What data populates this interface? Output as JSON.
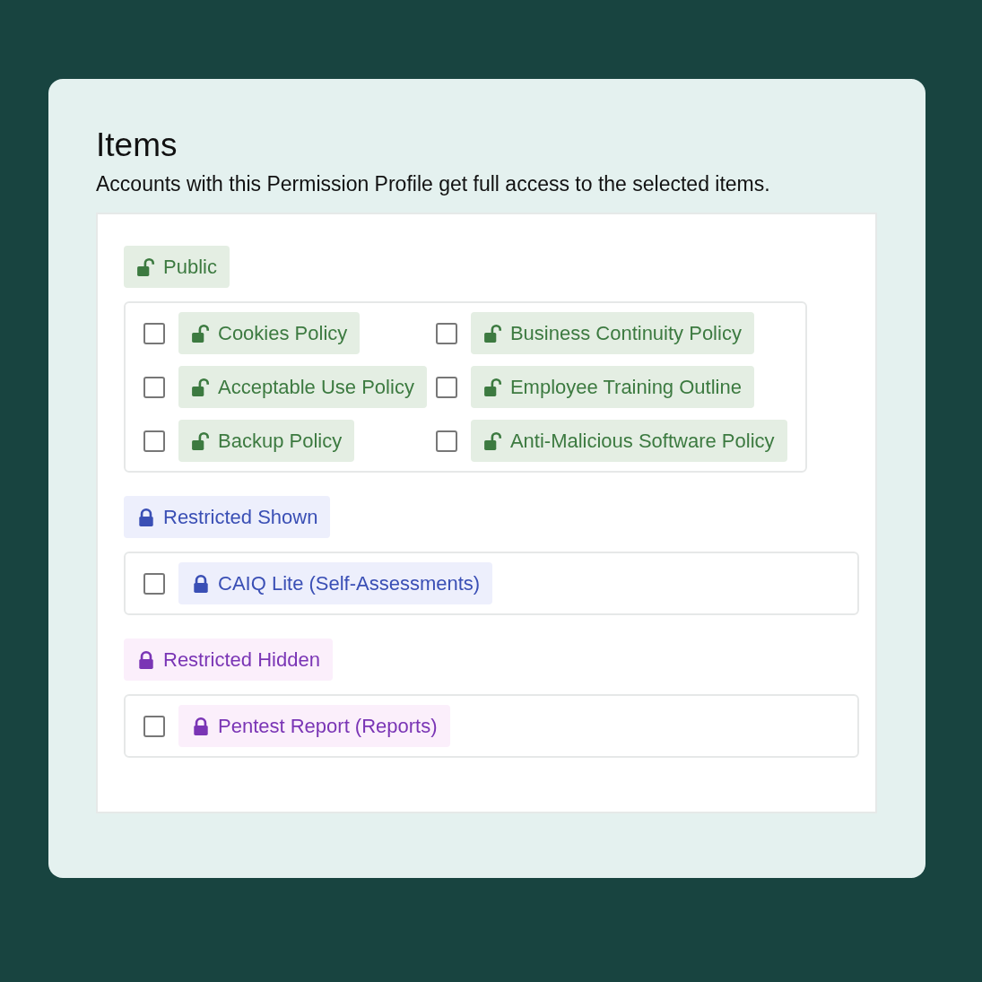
{
  "title": "Items",
  "description": "Accounts with this Permission Profile get full access to the selected items.",
  "groups": [
    {
      "kind": "public",
      "label": "Public",
      "items": [
        {
          "label": "Cookies Policy",
          "checked": false
        },
        {
          "label": "Business Continuity Policy",
          "checked": false
        },
        {
          "label": "Acceptable Use Policy",
          "checked": false
        },
        {
          "label": "Employee Training Outline",
          "checked": false
        },
        {
          "label": "Backup Policy",
          "checked": false
        },
        {
          "label": "Anti-Malicious Software Policy",
          "checked": false
        }
      ]
    },
    {
      "kind": "restricted_shown",
      "label": "Restricted Shown",
      "items": [
        {
          "label": "CAIQ Lite (Self-Assessments)",
          "checked": false
        }
      ]
    },
    {
      "kind": "restricted_hidden",
      "label": "Restricted Hidden",
      "items": [
        {
          "label": "Pentest Report (Reports)",
          "checked": false
        }
      ]
    }
  ]
}
